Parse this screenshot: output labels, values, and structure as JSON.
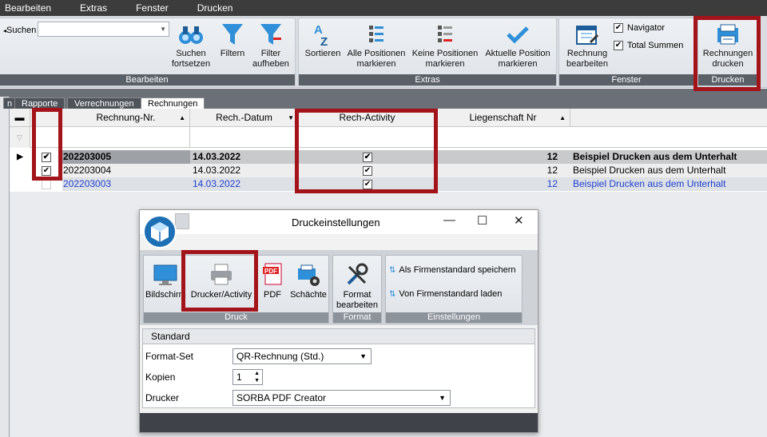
{
  "menu": [
    "Bearbeiten",
    "Extras",
    "Fenster",
    "Drucken"
  ],
  "search": {
    "label": "Suchen",
    "value": ""
  },
  "ribbon": {
    "groups": {
      "bearbeiten": "Bearbeiten",
      "extras": "Extras",
      "fenster": "Fenster",
      "drucken": "Drucken"
    },
    "buttons": {
      "suchen_fortsetzen": [
        "Suchen",
        "fortsetzen"
      ],
      "filtern": [
        "Filtern",
        ""
      ],
      "filter_aufheben": [
        "Filter",
        "aufheben"
      ],
      "sortieren": [
        "Sortieren",
        ""
      ],
      "alle_positionen": [
        "Alle Positionen",
        "markieren"
      ],
      "keine_positionen": [
        "Keine Positionen",
        "markieren"
      ],
      "aktuelle_position": [
        "Aktuelle Position",
        "markieren"
      ],
      "rechnung_bearbeiten": [
        "Rechnung",
        "bearbeiten"
      ],
      "rechnungen_drucken": [
        "Rechnungen",
        "drucken"
      ]
    },
    "navigator": {
      "label": "Navigator",
      "checked": true
    },
    "total_summen": {
      "label": "Total Summen",
      "checked": true
    }
  },
  "tabs": [
    {
      "label": "n",
      "active": false
    },
    {
      "label": "Rapporte",
      "active": false
    },
    {
      "label": "Verrechnungen",
      "active": false
    },
    {
      "label": "Rechnungen",
      "active": true
    }
  ],
  "grid": {
    "columns": [
      "Rechnung-Nr.",
      "Rech.-Datum",
      "Rech-Activity",
      "Liegenschaft Nr"
    ],
    "rows": [
      {
        "nr": "202203005",
        "datum": "14.03.2022",
        "activity": true,
        "liegenschaft": "12",
        "text": "Beispiel Drucken aus dem Unterhalt",
        "checked": true,
        "current": true
      },
      {
        "nr": "202203004",
        "datum": "14.03.2022",
        "activity": true,
        "liegenschaft": "12",
        "text": "Beispiel Drucken aus dem Unterhalt",
        "checked": true,
        "current": false
      },
      {
        "nr": "202203003",
        "datum": "14.03.2022",
        "activity": true,
        "liegenschaft": "12",
        "text": "Beispiel Drucken aus dem Unterhalt",
        "checked": false,
        "current": false
      }
    ]
  },
  "dialog": {
    "title": "Druckeinstellungen",
    "buttons": {
      "bildschirm": "Bildschirm",
      "drucker_activity": "Drucker/Activity",
      "pdf": "PDF",
      "schaechte": "Schächte",
      "format_bearbeiten": [
        "Format",
        "bearbeiten"
      ],
      "als_firmenstandard": "Als Firmenstandard speichern",
      "von_firmenstandard": "Von Firmenstandard laden"
    },
    "groups": {
      "druck": "Druck",
      "format": "Format",
      "einstellungen": "Einstellungen"
    },
    "section": "Standard",
    "fields": {
      "format_set": {
        "label": "Format-Set",
        "value": "QR-Rechnung (Std.)"
      },
      "kopien": {
        "label": "Kopien",
        "value": "1"
      },
      "drucker": {
        "label": "Drucker",
        "value": "SORBA PDF Creator"
      }
    }
  },
  "colors": {
    "highlight": "#a3131a",
    "link_row": "#1f3fd1",
    "menubar": "#3c3c3c"
  }
}
